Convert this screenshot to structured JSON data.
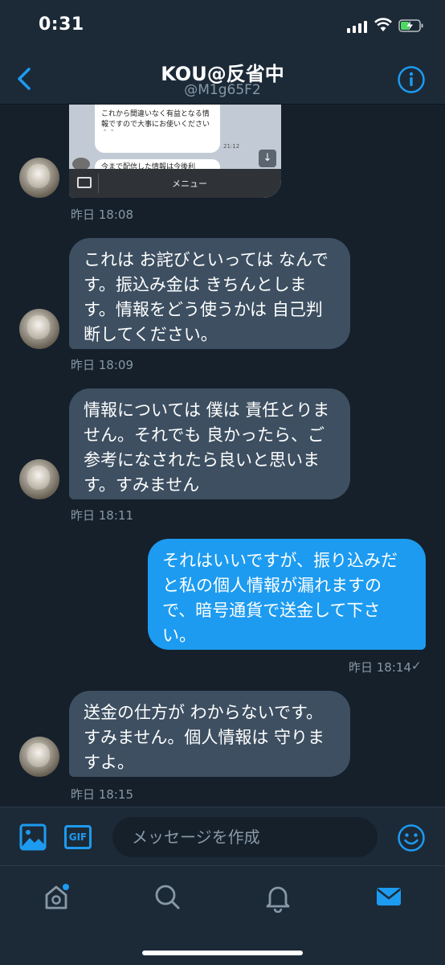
{
  "status_bar": {
    "time": "0:31"
  },
  "header": {
    "title": "KOU@反省中",
    "handle": "@M1g65F2"
  },
  "screenshot_image": {
    "bubble1_text": "これから間違いなく有益となる情報ですので大事にお使いください＾＾",
    "bubble1_time": "21:12",
    "bubble2_text": "今まで配信した情報は今後利",
    "menu_label": "メニュー"
  },
  "messages": [
    {
      "direction": "in",
      "text": "これは お詫びといっては なんです。振込み金は きちんとします。情報をどう使うかは 自己判断してください。",
      "time": "昨日 18:09"
    },
    {
      "direction": "in",
      "text": "情報については 僕は 責任とりません。それでも 良かったら、ご参考になされたら良いと思います。すみません",
      "time": "昨日 18:11"
    },
    {
      "direction": "out",
      "text": "それはいいですが、振り込みだと私の個人情報が漏れますので、暗号通貨で送金して下さい。",
      "time": "昨日 18:14",
      "read_mark": "✓"
    },
    {
      "direction": "in",
      "text": "送金の仕方が わからないです。すみません。個人情報は 守りますよ。",
      "time": "昨日 18:15"
    }
  ],
  "image_message_time": "昨日 18:08",
  "composer": {
    "placeholder": "メッセージを作成",
    "gif_label": "GIF"
  },
  "tabs": [
    "home-icon",
    "search-icon",
    "notifications-icon",
    "messages-icon"
  ],
  "colors": {
    "background": "#15202b",
    "accent": "#1d9bf0",
    "incoming_bubble": "#3d4f61",
    "muted_text": "#8899a6"
  }
}
